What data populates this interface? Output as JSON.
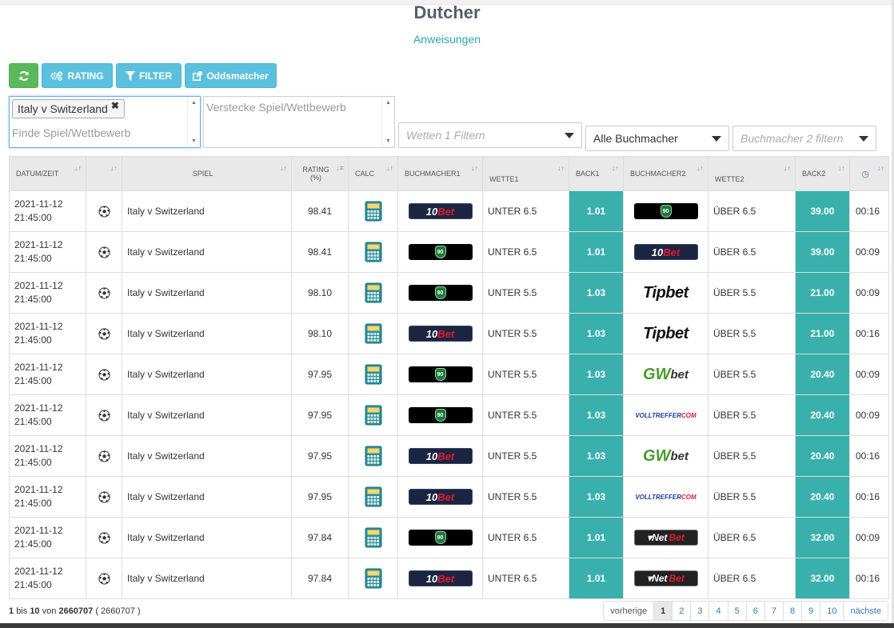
{
  "header": {
    "title": "Dutcher",
    "subtitle_link": "Anweisungen"
  },
  "toolbar": {
    "refresh_icon": "refresh-icon",
    "rating_label": "RATING",
    "filter_label": "FILTER",
    "oddsmatcher_label": "Oddsmatcher",
    "colors": {
      "success": "#5cb85c",
      "info": "#5bc0de"
    }
  },
  "filters": {
    "selected_game_tag": "Italy v Switzerland",
    "game_search_placeholder": "Finde Spiel/Wettbewerb",
    "hide_game_placeholder": "Verstecke Spiel/Wettbewerb",
    "bet1_placeholder": "Wetten 1 Filtern",
    "bookmaker1_value": "Alle Buchmacher",
    "bookmaker2_placeholder": "Buchmacher 2 filtern"
  },
  "table": {
    "headers": {
      "date": "DATUM/ZEIT",
      "game": "SPIEL",
      "rating": "RATING",
      "rating_unit": "(%)",
      "calc": "CALC",
      "bookmaker1": "BUCHMACHER1",
      "bet1": "WETTE1",
      "back1": "BACK1",
      "bookmaker2": "BUCHMACHER2",
      "bet2": "WETTE2",
      "back2": "BACK2"
    },
    "accent_color": "#3ab0ad",
    "rows": [
      {
        "date": "2021-11-12",
        "time": "21:45:00",
        "game": "Italy v Switzerland",
        "rating": "98.41",
        "bm1": "10bet",
        "bet1": "UNTER 6.5",
        "back1": "1.01",
        "bm2": "bet90",
        "bet2": "ÜBER 6.5",
        "back2": "39.00",
        "age": "00:16"
      },
      {
        "date": "2021-11-12",
        "time": "21:45:00",
        "game": "Italy v Switzerland",
        "rating": "98.41",
        "bm1": "bet90",
        "bet1": "UNTER 6.5",
        "back1": "1.01",
        "bm2": "10bet",
        "bet2": "ÜBER 6.5",
        "back2": "39.00",
        "age": "00:09"
      },
      {
        "date": "2021-11-12",
        "time": "21:45:00",
        "game": "Italy v Switzerland",
        "rating": "98.10",
        "bm1": "bet90",
        "bet1": "UNTER 5.5",
        "back1": "1.03",
        "bm2": "tipbet",
        "bet2": "ÜBER 5.5",
        "back2": "21.00",
        "age": "00:09"
      },
      {
        "date": "2021-11-12",
        "time": "21:45:00",
        "game": "Italy v Switzerland",
        "rating": "98.10",
        "bm1": "10bet",
        "bet1": "UNTER 5.5",
        "back1": "1.03",
        "bm2": "tipbet",
        "bet2": "ÜBER 5.5",
        "back2": "21.00",
        "age": "00:16"
      },
      {
        "date": "2021-11-12",
        "time": "21:45:00",
        "game": "Italy v Switzerland",
        "rating": "97.95",
        "bm1": "bet90",
        "bet1": "UNTER 5.5",
        "back1": "1.03",
        "bm2": "gwbet",
        "bet2": "ÜBER 5.5",
        "back2": "20.40",
        "age": "00:09"
      },
      {
        "date": "2021-11-12",
        "time": "21:45:00",
        "game": "Italy v Switzerland",
        "rating": "97.95",
        "bm1": "bet90",
        "bet1": "UNTER 5.5",
        "back1": "1.03",
        "bm2": "volltreffer",
        "bet2": "ÜBER 5.5",
        "back2": "20.40",
        "age": "00:09"
      },
      {
        "date": "2021-11-12",
        "time": "21:45:00",
        "game": "Italy v Switzerland",
        "rating": "97.95",
        "bm1": "10bet",
        "bet1": "UNTER 5.5",
        "back1": "1.03",
        "bm2": "gwbet",
        "bet2": "ÜBER 5.5",
        "back2": "20.40",
        "age": "00:16"
      },
      {
        "date": "2021-11-12",
        "time": "21:45:00",
        "game": "Italy v Switzerland",
        "rating": "97.95",
        "bm1": "10bet",
        "bet1": "UNTER 5.5",
        "back1": "1.03",
        "bm2": "volltreffer",
        "bet2": "ÜBER 5.5",
        "back2": "20.40",
        "age": "00:16"
      },
      {
        "date": "2021-11-12",
        "time": "21:45:00",
        "game": "Italy v Switzerland",
        "rating": "97.84",
        "bm1": "bet90",
        "bet1": "UNTER 6.5",
        "back1": "1.01",
        "bm2": "netbet",
        "bet2": "ÜBER 6.5",
        "back2": "32.00",
        "age": "00:09"
      },
      {
        "date": "2021-11-12",
        "time": "21:45:00",
        "game": "Italy v Switzerland",
        "rating": "97.84",
        "bm1": "10bet",
        "bet1": "UNTER 6.5",
        "back1": "1.01",
        "bm2": "netbet",
        "bet2": "ÜBER 6.5",
        "back2": "32.00",
        "age": "00:16"
      }
    ]
  },
  "logos": {
    "10bet": {
      "a": "10",
      "b": "Bet"
    },
    "bet90": {
      "badge": "90"
    },
    "tipbet": {
      "text": "Tipbet"
    },
    "gwbet": {
      "a": "GW",
      "b": "bet"
    },
    "volltreffer": {
      "a": "VOLLTREFFER",
      "b": "COM"
    },
    "netbet": {
      "a": "Net",
      "b": "Bet"
    }
  },
  "footer": {
    "from": "1",
    "bis": "bis",
    "to": "10",
    "von": "von",
    "total": "2660707",
    "total_paren": "( 2660707 )",
    "prev": "vorherige",
    "next": "nächste",
    "pages": [
      "1",
      "2",
      "3",
      "4",
      "5",
      "6",
      "7",
      "8",
      "9",
      "10"
    ],
    "active_page": "1"
  }
}
